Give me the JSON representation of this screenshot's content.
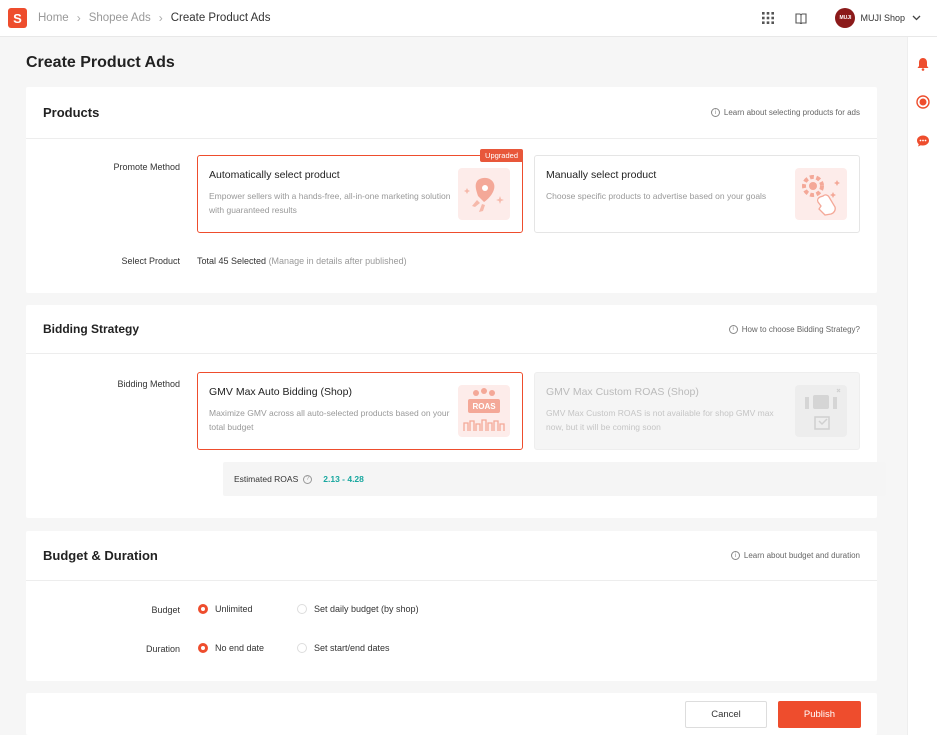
{
  "breadcrumb": {
    "home": "Home",
    "ads": "Shopee Ads",
    "current": "Create Product Ads"
  },
  "logo_letter": "S",
  "shop": {
    "avatar_text": "MUJI",
    "name": "MUJI Shop"
  },
  "page_title": "Create Product Ads",
  "products": {
    "title": "Products",
    "help": "Learn about selecting products for ads",
    "promote_label": "Promote Method",
    "auto": {
      "badge": "Upgraded",
      "title": "Automatically select product",
      "desc": "Empower sellers with a hands-free, all-in-one marketing solution with guaranteed results"
    },
    "manual": {
      "title": "Manually select product",
      "desc": "Choose specific products to advertise based on your goals"
    },
    "select_label": "Select Product",
    "select_value": "Total 45 Selected",
    "select_note": "(Manage in details after published)"
  },
  "bidding": {
    "title": "Bidding Strategy",
    "help": "How to choose Bidding Strategy?",
    "method_label": "Bidding Method",
    "auto": {
      "title": "GMV Max Auto Bidding (Shop)",
      "desc": "Maximize GMV across all auto-selected products based on your total budget",
      "illu_text": "ROAS"
    },
    "custom": {
      "title": "GMV Max Custom ROAS (Shop)",
      "desc": "GMV Max Custom ROAS is not available for shop GMV max now, but it will be coming soon"
    },
    "roas_label": "Estimated ROAS",
    "roas_value": "2.13 - 4.28"
  },
  "budget": {
    "title": "Budget & Duration",
    "help": "Learn about budget and duration",
    "budget_label": "Budget",
    "budget_opt1": "Unlimited",
    "budget_opt2": "Set daily budget (by shop)",
    "duration_label": "Duration",
    "duration_opt1": "No end date",
    "duration_opt2": "Set start/end dates"
  },
  "footer": {
    "cancel": "Cancel",
    "publish": "Publish"
  },
  "colors": {
    "accent": "#ee4d2d",
    "roas": "#18a79f"
  }
}
